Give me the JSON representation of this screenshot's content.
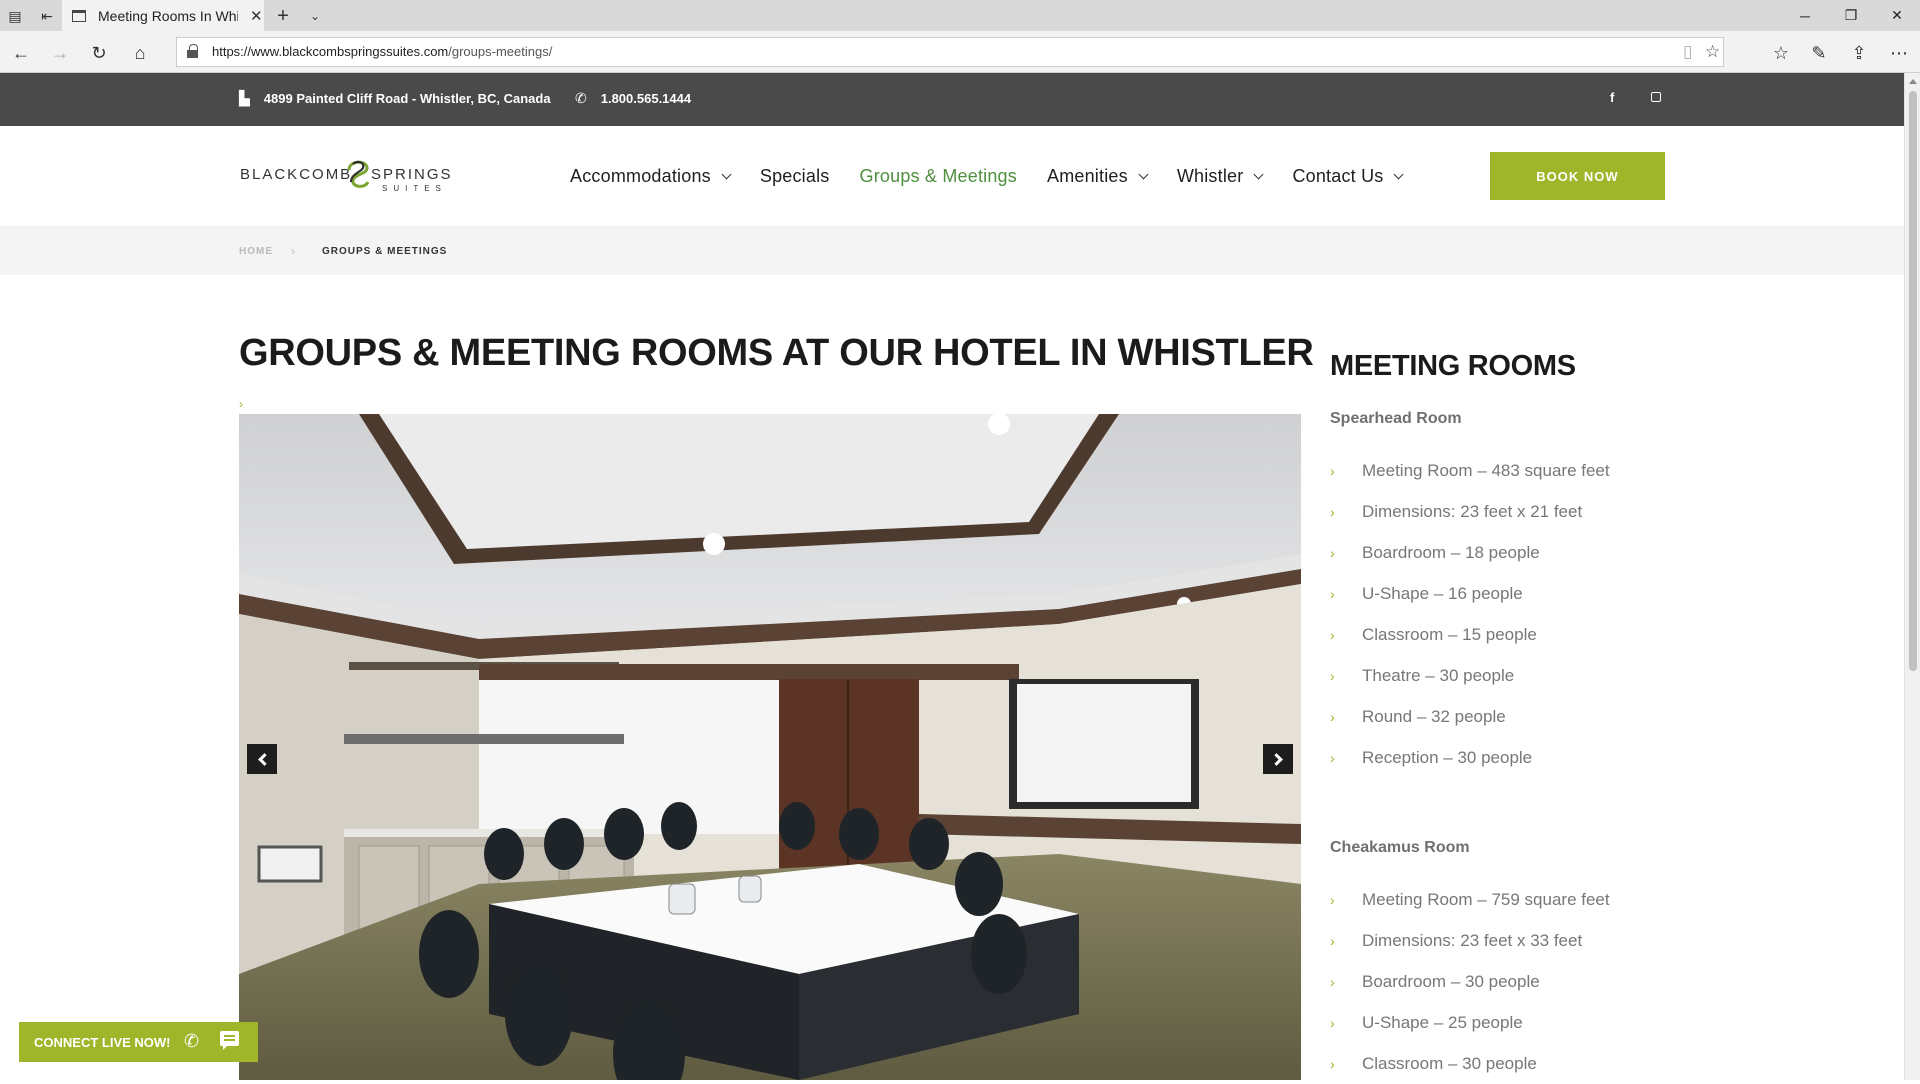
{
  "browser": {
    "tab_title": "Meeting Rooms In Whistler",
    "url_host": "https://www.blackcombspringssuites.com",
    "url_path": "/groups-meetings/"
  },
  "topbar": {
    "address": "4899 Painted Cliff Road - Whistler, BC, Canada",
    "phone": "1.800.565.1444",
    "facebook": "f",
    "instagram_icon": "instagram-icon"
  },
  "logo": {
    "word1": "BLACKCOMB",
    "word2": "SPRINGS",
    "word3": "SUITES"
  },
  "nav": {
    "items": [
      {
        "label": "Accommodations"
      },
      {
        "label": "Specials"
      },
      {
        "label": "Groups & Meetings"
      },
      {
        "label": "Amenities"
      },
      {
        "label": "Whistler"
      },
      {
        "label": "Contact Us"
      }
    ],
    "book_now": "BOOK NOW"
  },
  "breadcrumb": {
    "home": "HOME",
    "current": "GROUPS & MEETINGS"
  },
  "main": {
    "title": "GROUPS & MEETING ROOMS AT OUR HOTEL IN WHISTLER"
  },
  "sidebar": {
    "title": "MEETING ROOMS",
    "rooms": [
      {
        "name": "Spearhead Room",
        "details": [
          "Meeting Room – 483 square feet",
          "Dimensions: 23 feet x 21 feet",
          "Boardroom – 18 people",
          "U-Shape – 16 people",
          "Classroom – 15 people",
          "Theatre – 30 people",
          "Round – 32 people",
          "Reception – 30 people"
        ]
      },
      {
        "name": "Cheakamus Room",
        "details": [
          "Meeting Room – 759 square feet",
          "Dimensions: 23 feet x 33 feet",
          "Boardroom – 30 people",
          "U-Shape – 25 people",
          "Classroom – 30 people"
        ]
      }
    ]
  },
  "connect": {
    "label": "CONNECT LIVE NOW!"
  },
  "colors": {
    "accent": "#9fb52a",
    "nav_active": "#4f8f3d",
    "topbar": "#4a4a4a"
  }
}
